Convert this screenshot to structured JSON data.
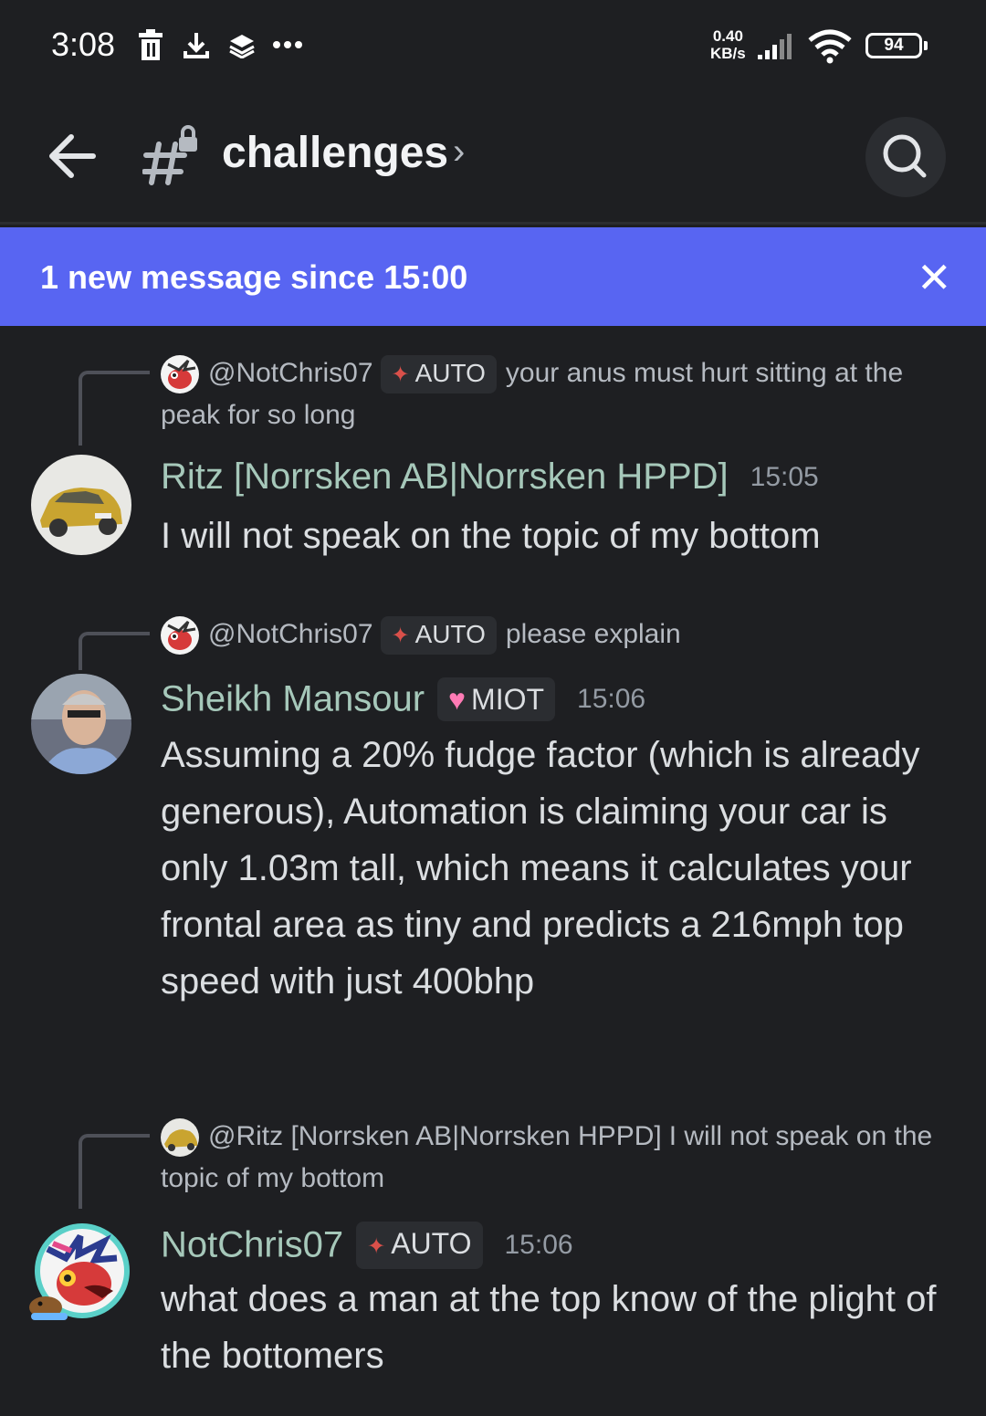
{
  "status_bar": {
    "time": "3:08",
    "icons": [
      "trash-icon",
      "download-icon",
      "layers-icon",
      "more-icon"
    ],
    "net_speed_value": "0.40",
    "net_speed_unit": "KB/s",
    "battery": "94"
  },
  "header": {
    "channel": "challenges",
    "chevron": "›"
  },
  "new_message_bar": {
    "text": "1 new message since 15:00",
    "close": "✕"
  },
  "messages": [
    {
      "reply": {
        "user": "@NotChris07",
        "tag": "AUTO",
        "text": "your anus must hurt sitting at the peak for so long"
      },
      "author": "Ritz [Norrsken AB|Norrsken HPPD]",
      "time": "15:05",
      "content": "I will not speak on the topic of my bottom"
    },
    {
      "reply": {
        "user": "@NotChris07",
        "tag": "AUTO",
        "text": "please explain"
      },
      "author": "Sheikh Mansour",
      "tag": "MIOT",
      "time": "15:06",
      "content": "Assuming a 20% fudge factor (which is already generous), Automation is claiming your car is only 1.03m tall, which means it calculates your frontal area as tiny and predicts a 216mph top speed with just 400bhp"
    },
    {
      "reply": {
        "user": "@Ritz [Norrsken AB|Norrsken HPPD]",
        "text": "I will not speak on the topic of my bottom"
      },
      "author": "NotChris07",
      "tag": "AUTO",
      "time": "15:06",
      "content": "what does a man at the top know of the plight of the bottomers"
    }
  ]
}
